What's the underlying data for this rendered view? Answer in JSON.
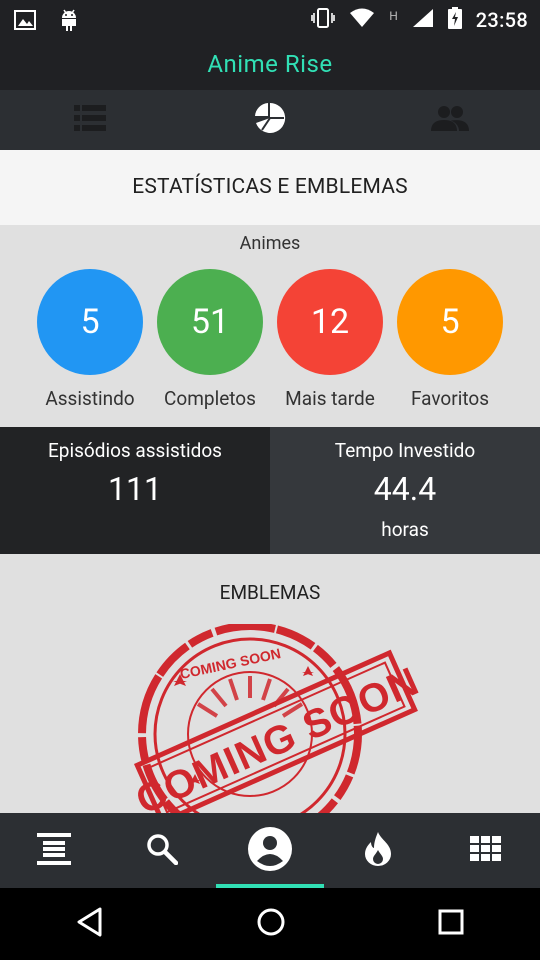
{
  "status_bar": {
    "time": "23:58",
    "icons": [
      "image-icon",
      "android-icon",
      "vibrate-icon",
      "wifi-icon",
      "network-h-icon",
      "signal-icon",
      "battery-charging-icon"
    ],
    "network_type": "H"
  },
  "app": {
    "title": "Anime Rise",
    "accent_color": "#31e0b5"
  },
  "top_tabs": [
    {
      "icon": "list-icon",
      "active": false
    },
    {
      "icon": "pie-chart-icon",
      "active": true
    },
    {
      "icon": "people-icon",
      "active": false
    }
  ],
  "section": {
    "title": "ESTATÍSTICAS E EMBLEMAS"
  },
  "animes": {
    "title": "Animes",
    "stats": [
      {
        "value": "5",
        "label": "Assistindo",
        "color": "#2196f3"
      },
      {
        "value": "51",
        "label": "Completos",
        "color": "#4caf50"
      },
      {
        "value": "12",
        "label": "Mais tarde",
        "color": "#f44336"
      },
      {
        "value": "5",
        "label": "Favoritos",
        "color": "#ff9800"
      }
    ]
  },
  "counters": {
    "episodes": {
      "label": "Episódios assistidos",
      "value": "111"
    },
    "time": {
      "label": "Tempo Investido",
      "value": "44.4",
      "unit": "horas"
    }
  },
  "emblems": {
    "title": "EMBLEMAS",
    "stamp_text_main": "COMING SOON",
    "stamp_text_small": "COMING SOON",
    "stamp_color": "#d0282e"
  },
  "bottom_nav": [
    {
      "icon": "feed-icon",
      "active": false
    },
    {
      "icon": "search-icon",
      "active": false
    },
    {
      "icon": "account-circle-icon",
      "active": true
    },
    {
      "icon": "fire-icon",
      "active": false
    },
    {
      "icon": "grid-icon",
      "active": false
    }
  ],
  "system_nav": [
    "back-icon",
    "home-icon",
    "recents-icon"
  ]
}
